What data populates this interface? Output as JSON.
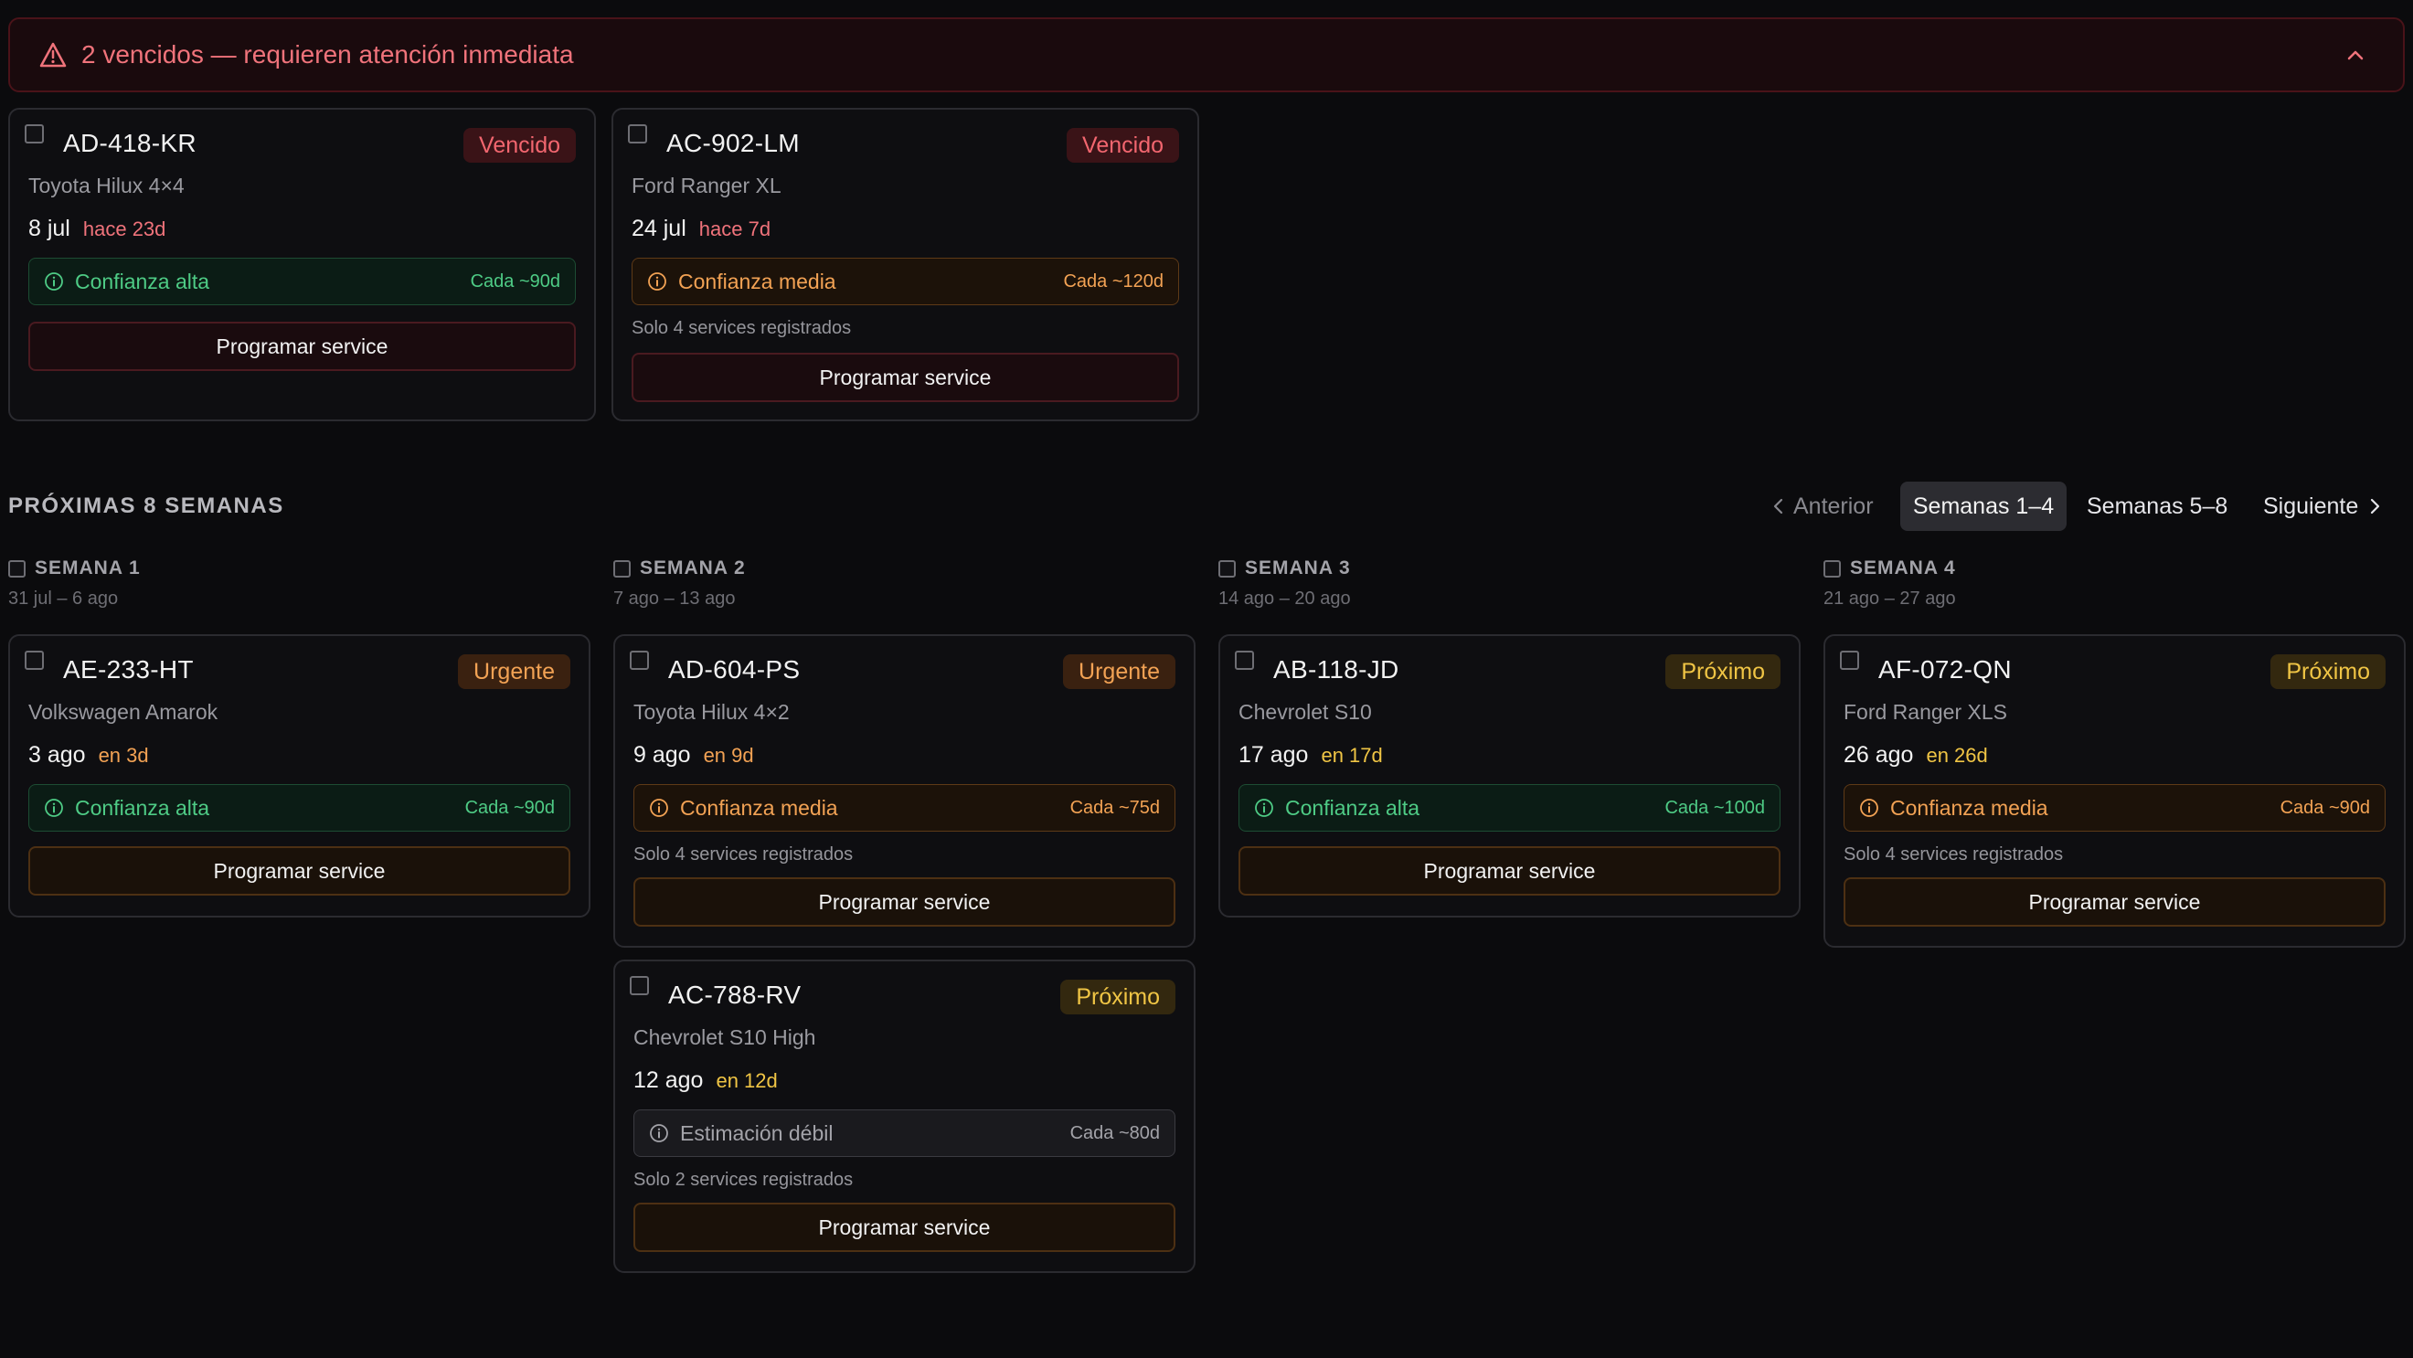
{
  "alert": {
    "text": "2 vencidos — requieren atención inmediata",
    "icon": "warning-triangle-icon",
    "toggle_icon": "chevron-up-icon"
  },
  "overdue": [
    {
      "plate": "AD-418-KR",
      "badge": "Vencido",
      "model": "Toyota Hilux 4×4",
      "date": "8 jul",
      "relative": "hace 23d",
      "confidence": "Confianza alta",
      "period": "Cada ~90d",
      "note": "",
      "button": "Programar service"
    },
    {
      "plate": "AC-902-LM",
      "badge": "Vencido",
      "model": "Ford Ranger XL",
      "date": "24 jul",
      "relative": "hace 7d",
      "confidence": "Confianza media",
      "period": "Cada ~120d",
      "note": "Solo 4 services registrados",
      "button": "Programar service"
    }
  ],
  "upcoming": {
    "title": "PRÓXIMAS 8 SEMANAS",
    "pagination": {
      "prev": "Anterior",
      "active": "Semanas 1–4",
      "other": "Semanas 5–8",
      "next": "Siguiente"
    },
    "weeks": [
      {
        "label": "SEMANA 1",
        "range": "31 jul – 6 ago",
        "items": [
          {
            "plate": "AE-233-HT",
            "badge": "Urgente",
            "model": "Volkswagen Amarok",
            "date": "3 ago",
            "relative": "en 3d",
            "confidence": "Confianza alta",
            "period": "Cada ~90d",
            "note": "",
            "button": "Programar service"
          }
        ]
      },
      {
        "label": "SEMANA 2",
        "range": "7 ago – 13 ago",
        "items": [
          {
            "plate": "AD-604-PS",
            "badge": "Urgente",
            "model": "Toyota Hilux 4×2",
            "date": "9 ago",
            "relative": "en 9d",
            "confidence": "Confianza media",
            "period": "Cada ~75d",
            "note": "Solo 4 services registrados",
            "button": "Programar service"
          },
          {
            "plate": "AC-788-RV",
            "badge": "Próximo",
            "model": "Chevrolet S10 High",
            "date": "12 ago",
            "relative": "en 12d",
            "confidence": "Estimación débil",
            "period": "Cada ~80d",
            "note": "Solo 2 services registrados",
            "button": "Programar service"
          }
        ]
      },
      {
        "label": "SEMANA 3",
        "range": "14 ago – 20 ago",
        "items": [
          {
            "plate": "AB-118-JD",
            "badge": "Próximo",
            "model": "Chevrolet S10",
            "date": "17 ago",
            "relative": "en 17d",
            "confidence": "Confianza alta",
            "period": "Cada ~100d",
            "note": "",
            "button": "Programar service"
          }
        ]
      },
      {
        "label": "SEMANA 4",
        "range": "21 ago – 27 ago",
        "items": [
          {
            "plate": "AF-072-QN",
            "badge": "Próximo",
            "model": "Ford Ranger XLS",
            "date": "26 ago",
            "relative": "en 26d",
            "confidence": "Confianza media",
            "period": "Cada ~90d",
            "note": "Solo 4 services registrados",
            "button": "Programar service"
          }
        ]
      }
    ]
  },
  "colors": {
    "danger": "#f0737b",
    "urgent": "#f2a254",
    "upcoming": "#f0c545",
    "high_confidence": "#4ecb85"
  }
}
